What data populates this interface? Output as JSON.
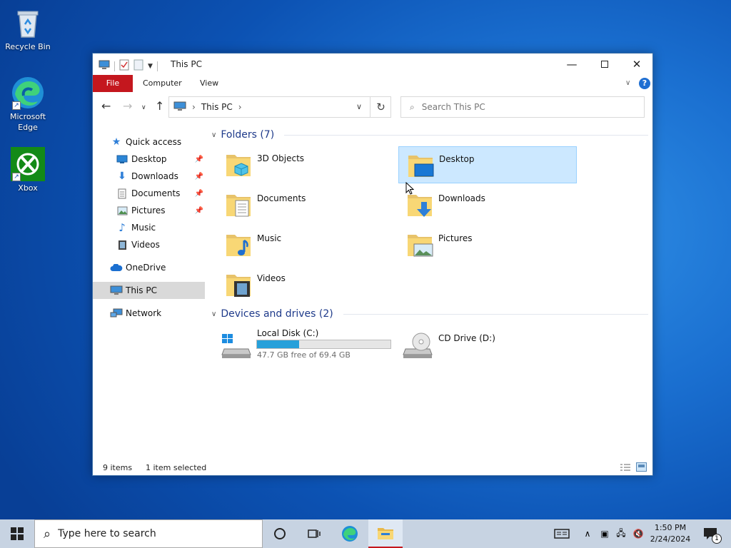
{
  "desktop": {
    "icons": [
      {
        "label": "Recycle Bin"
      },
      {
        "label": "Microsoft Edge"
      },
      {
        "label": "Xbox"
      }
    ]
  },
  "window": {
    "title": "This PC",
    "ribbon": {
      "file": "File",
      "computer": "Computer",
      "view": "View"
    },
    "address": {
      "location": "This PC"
    },
    "search": {
      "placeholder": "Search This PC"
    },
    "sidebar": {
      "quick_access": "Quick access",
      "items": [
        {
          "label": "Desktop",
          "pinned": true
        },
        {
          "label": "Downloads",
          "pinned": true
        },
        {
          "label": "Documents",
          "pinned": true
        },
        {
          "label": "Pictures",
          "pinned": true
        },
        {
          "label": "Music",
          "pinned": false
        },
        {
          "label": "Videos",
          "pinned": false
        }
      ],
      "onedrive": "OneDrive",
      "this_pc": "This PC",
      "network": "Network"
    },
    "folders_header": "Folders (7)",
    "folders": [
      {
        "name": "3D Objects"
      },
      {
        "name": "Desktop",
        "selected": true
      },
      {
        "name": "Documents"
      },
      {
        "name": "Downloads"
      },
      {
        "name": "Music"
      },
      {
        "name": "Pictures"
      },
      {
        "name": "Videos"
      }
    ],
    "drives_header": "Devices and drives (2)",
    "drives": [
      {
        "name": "Local Disk (C:)",
        "free_text": "47.7 GB free of 69.4 GB",
        "used_fraction": 0.313
      },
      {
        "name": "CD Drive (D:)"
      }
    ],
    "status": {
      "items": "9 items",
      "selected": "1 item selected"
    }
  },
  "taskbar": {
    "search_placeholder": "Type here to search",
    "time": "1:50 PM",
    "date": "2/24/2024",
    "notification_count": "1"
  },
  "colors": {
    "file_tab": "#c4171e",
    "selection": "#cce8ff",
    "drive_bar": "#26a0da",
    "group_header": "#1e3a8a"
  }
}
